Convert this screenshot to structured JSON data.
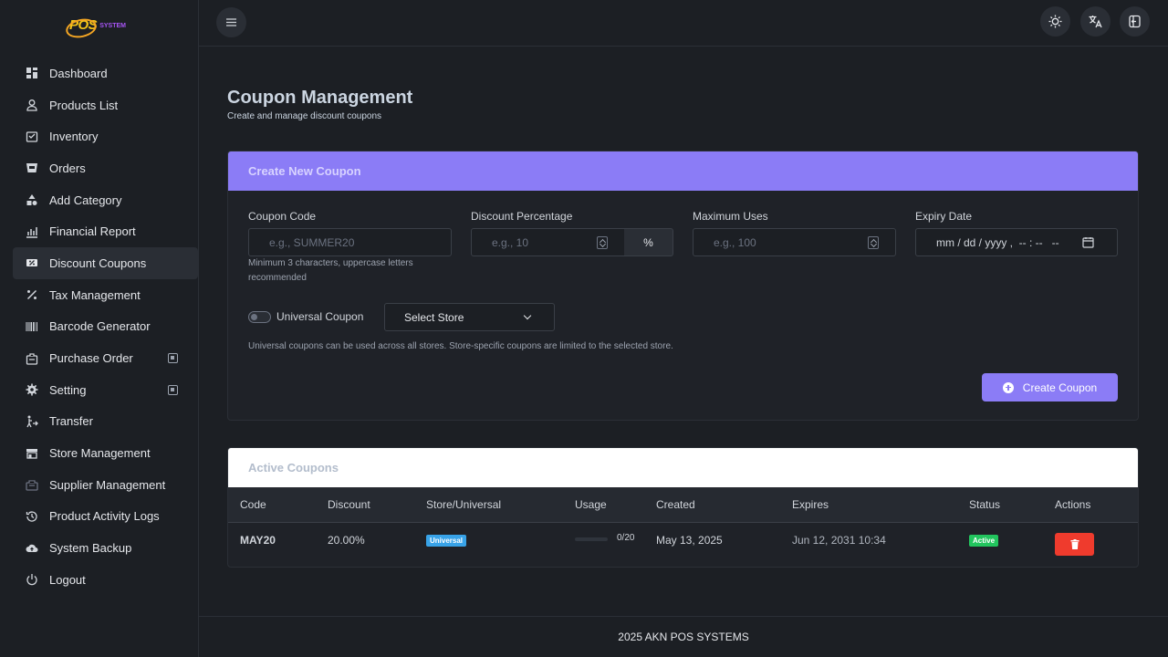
{
  "brand": {
    "logo_main": "POS",
    "logo_sub": "SYSTEM"
  },
  "sidebar": {
    "items": [
      {
        "label": "Dashboard",
        "icon": "dashboard-icon"
      },
      {
        "label": "Products List",
        "icon": "user-icon"
      },
      {
        "label": "Inventory",
        "icon": "inventory-icon"
      },
      {
        "label": "Orders",
        "icon": "orders-icon"
      },
      {
        "label": "Add Category",
        "icon": "category-icon"
      },
      {
        "label": "Financial Report",
        "icon": "report-icon"
      },
      {
        "label": "Discount Coupons",
        "icon": "coupon-icon",
        "active": true
      },
      {
        "label": "Tax Management",
        "icon": "percent-icon"
      },
      {
        "label": "Barcode Generator",
        "icon": "barcode-icon"
      },
      {
        "label": "Purchase Order",
        "icon": "purchase-icon",
        "expandable": true
      },
      {
        "label": "Setting",
        "icon": "gear-icon",
        "expandable": true
      },
      {
        "label": "Transfer",
        "icon": "transfer-icon"
      },
      {
        "label": "Store Management",
        "icon": "store-icon"
      },
      {
        "label": "Supplier Management",
        "icon": "supplier-icon"
      },
      {
        "label": "Product Activity Logs",
        "icon": "history-icon"
      },
      {
        "label": "System Backup",
        "icon": "cloud-upload-icon"
      },
      {
        "label": "Logout",
        "icon": "power-icon"
      }
    ]
  },
  "topbar": {
    "menu_icon": "hamburger-icon",
    "actions": [
      "theme-sun-icon",
      "translate-icon",
      "logout-door-icon"
    ]
  },
  "page": {
    "title": "Coupon Management",
    "subtitle": "Create and manage discount coupons"
  },
  "create_form": {
    "header": "Create New Coupon",
    "code_label": "Coupon Code",
    "code_placeholder": "e.g., SUMMER20",
    "code_hint": "Minimum 3 characters, uppercase letters recommended",
    "discount_label": "Discount Percentage",
    "discount_placeholder": "e.g., 10",
    "discount_suffix": "%",
    "max_uses_label": "Maximum Uses",
    "max_uses_placeholder": "e.g., 100",
    "expiry_label": "Expiry Date",
    "expiry_placeholder": "mm / dd / yyyy ,  -- : --   --",
    "universal_label": "Universal Coupon",
    "universal_enabled": false,
    "store_select": "Select Store",
    "scope_hint": "Universal coupons can be used across all stores. Store-specific coupons are limited to the selected store.",
    "submit_label": "Create Coupon"
  },
  "active_coupons": {
    "header": "Active Coupons",
    "columns": [
      "Code",
      "Discount",
      "Store/Universal",
      "Usage",
      "Created",
      "Expires",
      "Status",
      "Actions"
    ],
    "rows": [
      {
        "code": "MAY20",
        "discount": "20.00%",
        "scope": "Universal",
        "usage_text": "0/20",
        "usage_fraction": 0,
        "created": "May 13, 2025",
        "expires": "Jun 12, 2031 10:34",
        "status": "Active"
      }
    ]
  },
  "colors": {
    "accent": "#8b7cf6",
    "universal_badge": "#38a3e8",
    "active_badge": "#22c55e",
    "delete": "#ef3b2d"
  },
  "footer": {
    "text": "2025 AKN POS SYSTEMS"
  }
}
